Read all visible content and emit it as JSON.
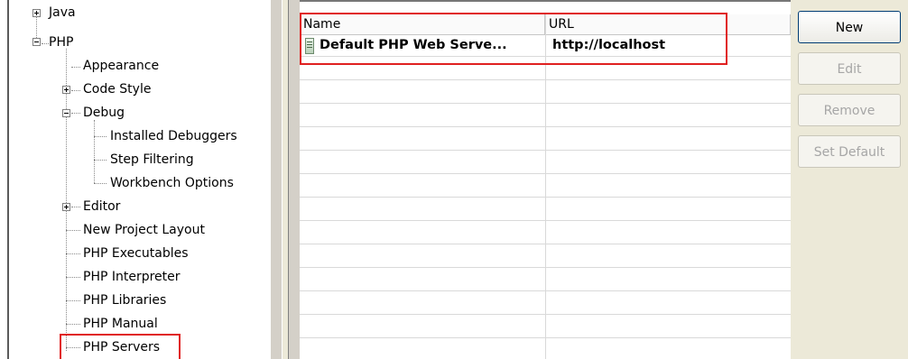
{
  "tree": {
    "items": [
      {
        "label": "Java",
        "expander": "plus"
      },
      {
        "label": "PHP",
        "expander": "minus"
      },
      {
        "label": "Appearance"
      },
      {
        "label": "Code Style",
        "expander": "plus"
      },
      {
        "label": "Debug",
        "expander": "minus"
      },
      {
        "label": "Installed Debuggers"
      },
      {
        "label": "Step Filtering"
      },
      {
        "label": "Workbench Options"
      },
      {
        "label": "Editor",
        "expander": "plus"
      },
      {
        "label": "New Project Layout"
      },
      {
        "label": "PHP Executables"
      },
      {
        "label": "PHP Interpreter"
      },
      {
        "label": "PHP Libraries"
      },
      {
        "label": "PHP Manual"
      },
      {
        "label": "PHP Servers"
      }
    ]
  },
  "table": {
    "columns": [
      "Name",
      "URL"
    ],
    "rows": [
      {
        "name": "Default PHP Web Serve...",
        "url": "http://localhost"
      }
    ]
  },
  "buttons": {
    "new": "New",
    "edit": "Edit",
    "remove": "Remove",
    "set_default": "Set Default"
  },
  "colors": {
    "highlight": "#e02020",
    "panel": "#ece9d8"
  }
}
